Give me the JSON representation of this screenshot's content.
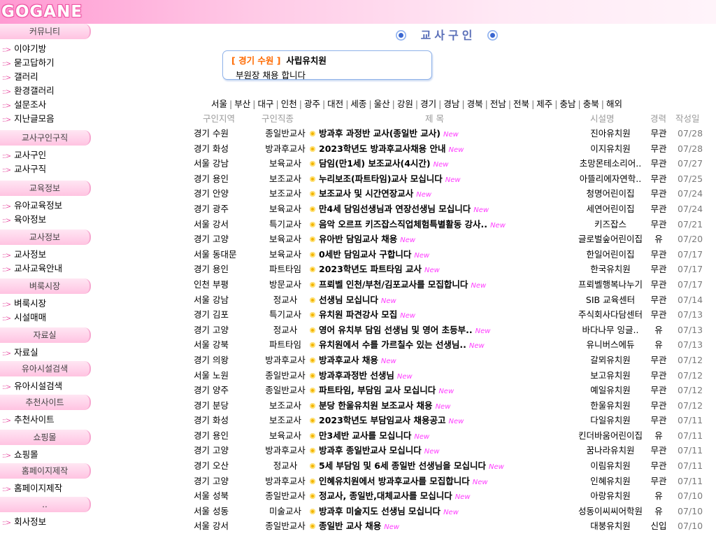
{
  "logo": "GOGANE",
  "sidebar": {
    "sections": [
      {
        "header": "커뮤니티",
        "items": [
          "이야기방",
          "묻고답하기",
          "갤러리",
          "환경갤러리",
          "설문조사",
          "지난글모음"
        ]
      },
      {
        "header": "교사구인구직",
        "items": [
          "교사구인",
          "교사구직"
        ]
      },
      {
        "header": "교육정보",
        "items": [
          "유아교육정보",
          "육아정보"
        ]
      },
      {
        "header": "교사정보",
        "items": [
          "교사정보",
          "교사교육안내"
        ]
      },
      {
        "header": "벼룩시장",
        "items": [
          "벼룩시장",
          "시설매매"
        ]
      },
      {
        "header": "자료실",
        "items": [
          "자료실"
        ]
      },
      {
        "header": "유아시설검색",
        "items": [
          "유아시설검색"
        ]
      },
      {
        "header": "추천사이트",
        "items": [
          "추천사이트"
        ]
      },
      {
        "header": "쇼핑몰",
        "items": [
          "쇼핑몰"
        ]
      },
      {
        "header": "홈페이지제작",
        "items": [
          "홈페이지제작"
        ]
      },
      {
        "header": "..",
        "items": [
          "회사정보"
        ]
      }
    ],
    "arrow": "::>"
  },
  "page_title": "교사구인",
  "featured": {
    "region": "[ 경기 수원 ]",
    "org": "사립유치원",
    "desc": "부원장 채용 합니다"
  },
  "regions": [
    "서울",
    "부산",
    "대구",
    "인천",
    "광주",
    "대전",
    "세종",
    "울산",
    "강원",
    "경기",
    "경남",
    "경북",
    "전남",
    "전북",
    "제주",
    "충남",
    "충북",
    "해외"
  ],
  "columns": {
    "region": "구인지역",
    "type": "구인직종",
    "title": "제 목",
    "school": "시설명",
    "career": "경력",
    "date": "작성일"
  },
  "new_label": "New",
  "listings": [
    {
      "region": "경기 수원",
      "type": "종일반교사",
      "title": "방과후 과정반 교사(종일반 교사)",
      "school": "진아유치원",
      "career": "무관",
      "date": "07/28"
    },
    {
      "region": "경기 화성",
      "type": "방과후교사",
      "title": "2023학년도 방과후교사채용 안내",
      "school": "이지유치원",
      "career": "무관",
      "date": "07/28"
    },
    {
      "region": "서울 강남",
      "type": "보육교사",
      "title": "담임(만1세) 보조교사(4시간)",
      "school": "초망몬테소리어..",
      "career": "무관",
      "date": "07/27"
    },
    {
      "region": "경기 용인",
      "type": "보조교사",
      "title": "누리보조(파트타임)교사 모십니다",
      "school": "아뜰리에자연학..",
      "career": "무관",
      "date": "07/25"
    },
    {
      "region": "경기 안양",
      "type": "보조교사",
      "title": "보조교사 및 시간연장교사",
      "school": "청명어린이집",
      "career": "무관",
      "date": "07/24"
    },
    {
      "region": "경기 광주",
      "type": "보육교사",
      "title": "만4세 담임선생님과 연장선생님 모십니다",
      "school": "세연어린이집",
      "career": "무관",
      "date": "07/24"
    },
    {
      "region": "서울 강서",
      "type": "특기교사",
      "title": "음악 오르프 키즈잡스직업체험특별활동 강사..",
      "school": "키즈잡스",
      "career": "무관",
      "date": "07/21"
    },
    {
      "region": "경기 고양",
      "type": "보육교사",
      "title": "유아반 담임교사 채용",
      "school": "글로벌숲어린이집",
      "career": "유",
      "date": "07/20"
    },
    {
      "region": "서울 동대문",
      "type": "보육교사",
      "title": "0세반 담임교사 구합니다",
      "school": "한일어린이집",
      "career": "무관",
      "date": "07/17"
    },
    {
      "region": "경기 용인",
      "type": "파트타임",
      "title": "2023학년도 파트타임 교사",
      "school": "한국유치원",
      "career": "무관",
      "date": "07/17"
    },
    {
      "region": "인천 부평",
      "type": "방문교사",
      "title": "프뢰벨 인천/부천/김포교사를 모집합니다",
      "school": "프뢰벨행복나누기",
      "career": "무관",
      "date": "07/17"
    },
    {
      "region": "서울 강남",
      "type": "정교사",
      "title": "선생님 모십니다",
      "school": "SIB 교육센터",
      "career": "무관",
      "date": "07/14"
    },
    {
      "region": "경기 김포",
      "type": "특기교사",
      "title": "유치원 파견강사 모집",
      "school": "주식회사다담센터",
      "career": "무관",
      "date": "07/13"
    },
    {
      "region": "경기 고양",
      "type": "정교사",
      "title": "영어 유치부 담임 선생님 및 영어 초등부..",
      "school": "바다나무 잉글..",
      "career": "유",
      "date": "07/13"
    },
    {
      "region": "서울 강북",
      "type": "파트타임",
      "title": "유치원에서 수를 가르칠수 있는 선생님..",
      "school": "유니버스에듀",
      "career": "유",
      "date": "07/13"
    },
    {
      "region": "경기 의왕",
      "type": "방과후교사",
      "title": "방과후교사 채용",
      "school": "갈뫼유치원",
      "career": "무관",
      "date": "07/12"
    },
    {
      "region": "서울 노원",
      "type": "종일반교사",
      "title": "방과후과정반 선생님",
      "school": "보고유치원",
      "career": "무관",
      "date": "07/12"
    },
    {
      "region": "경기 양주",
      "type": "종일반교사",
      "title": "파트타임, 부담임 교사 모십니다",
      "school": "예일유치원",
      "career": "무관",
      "date": "07/12"
    },
    {
      "region": "경기 분당",
      "type": "보조교사",
      "title": "분당 한울유치원 보조교사 채용",
      "school": "한울유치원",
      "career": "무관",
      "date": "07/12"
    },
    {
      "region": "경기 화성",
      "type": "보조교사",
      "title": "2023학년도 부담임교사 채용공고",
      "school": "다일유치원",
      "career": "무관",
      "date": "07/11"
    },
    {
      "region": "경기 용인",
      "type": "보육교사",
      "title": "만3세반 교사를 모십니다",
      "school": "킨더바움어린이집",
      "career": "유",
      "date": "07/11"
    },
    {
      "region": "경기 고양",
      "type": "방과후교사",
      "title": "방과후 종일반교사 모십니다",
      "school": "꿈나라유치원",
      "career": "무관",
      "date": "07/11"
    },
    {
      "region": "경기 오산",
      "type": "정교사",
      "title": "5세 부담임 및 6세 종일반 선생님을 모십니다",
      "school": "이림유치원",
      "career": "무관",
      "date": "07/11"
    },
    {
      "region": "경기 고양",
      "type": "방과후교사",
      "title": "인혜유치원에서 방과후교사를 모집합니다",
      "school": "인혜유치원",
      "career": "무관",
      "date": "07/11"
    },
    {
      "region": "서울 성북",
      "type": "종일반교사",
      "title": "정교사, 종일반,대체교사를 모십니다",
      "school": "아랑유치원",
      "career": "유",
      "date": "07/10"
    },
    {
      "region": "서울 성동",
      "type": "미술교사",
      "title": "방과후 미술지도 선생님 모십니다",
      "school": "성동이씨씨어학원",
      "career": "유",
      "date": "07/10"
    },
    {
      "region": "서울 강서",
      "type": "종일반교사",
      "title": "종일반 교사 채용",
      "school": "대붕유치원",
      "career": "신입",
      "date": "07/10"
    }
  ],
  "colors": {
    "accent_pink": "#ff9ad2",
    "region_orange": "#ff6a00",
    "new_magenta": "#ff3cff",
    "title_blue": "#5a6fb8"
  }
}
